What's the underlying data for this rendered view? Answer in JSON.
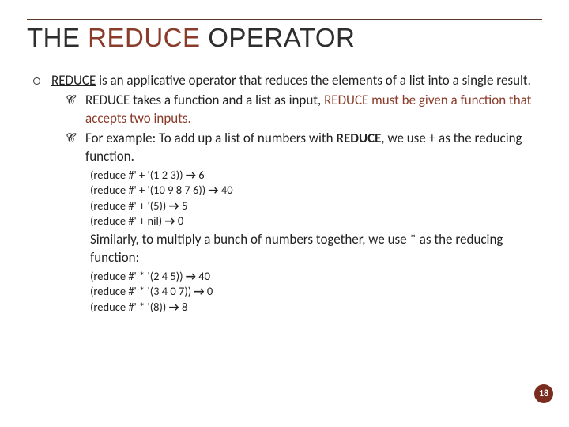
{
  "title_prefix": "THE ",
  "title_accent": "REDUCE ",
  "title_suffix": "OPERATOR",
  "intro_underline": "REDUCE",
  "intro_rest": " is an applicative operator that reduces the elements of a list into a single result.",
  "sub1_a": "REDUCE takes a function and a list as input, ",
  "sub1_accent": "REDUCE must be given a function that accepts two inputs.",
  "sub2_a": "For example: To add up a list of numbers with ",
  "sub2_bold": "REDUCE",
  "sub2_b": ", we use + as the reducing function.",
  "code1": [
    {
      "expr": "(reduce #' + '(1 2 3))",
      "res": "6"
    },
    {
      "expr": "(reduce #' + '(10 9 8 7 6))",
      "res": "40"
    },
    {
      "expr": "(reduce #' + '(5))",
      "res": "5"
    },
    {
      "expr": "(reduce #' + nil)",
      "res": "0"
    }
  ],
  "followup": "Similarly, to multiply a bunch of numbers together, we use * as the reducing function:",
  "code2": [
    {
      "expr": "(reduce #' * '(2 4 5))",
      "res": "40"
    },
    {
      "expr": "(reduce #' * '(3 4 0 7))",
      "res": "0"
    },
    {
      "expr": "(reduce #' * '(8))",
      "res": "8"
    }
  ],
  "page_number": "18",
  "arrow_glyph": "→"
}
